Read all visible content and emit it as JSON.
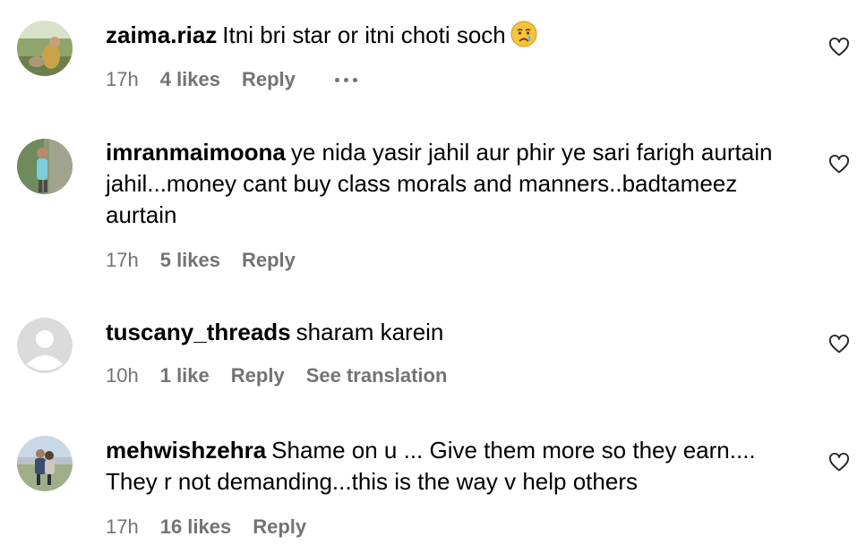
{
  "comments": [
    {
      "username": "zaima.riaz",
      "text": "Itni bri star or itni choti soch",
      "emoji": "crying-face-emoji",
      "time": "17h",
      "likes": "4 likes",
      "reply": "Reply",
      "has_more": true
    },
    {
      "username": "imranmaimoona",
      "text": "ye nida yasir jahil aur phir ye sari farigh aurtain jahil...money cant buy class morals and manners..badtameez aurtain",
      "time": "17h",
      "likes": "5 likes",
      "reply": "Reply"
    },
    {
      "username": "tuscany_threads",
      "text": "sharam karein",
      "time": "10h",
      "likes": "1 like",
      "reply": "Reply",
      "translate": "See translation"
    },
    {
      "username": "mehwishzehra",
      "text": "Shame on u ... Give them more so they earn.... They r not demanding...this is the way v help others",
      "time": "17h",
      "likes": "16 likes",
      "reply": "Reply"
    }
  ],
  "colors": {
    "text": "#000000",
    "meta": "#737373"
  }
}
